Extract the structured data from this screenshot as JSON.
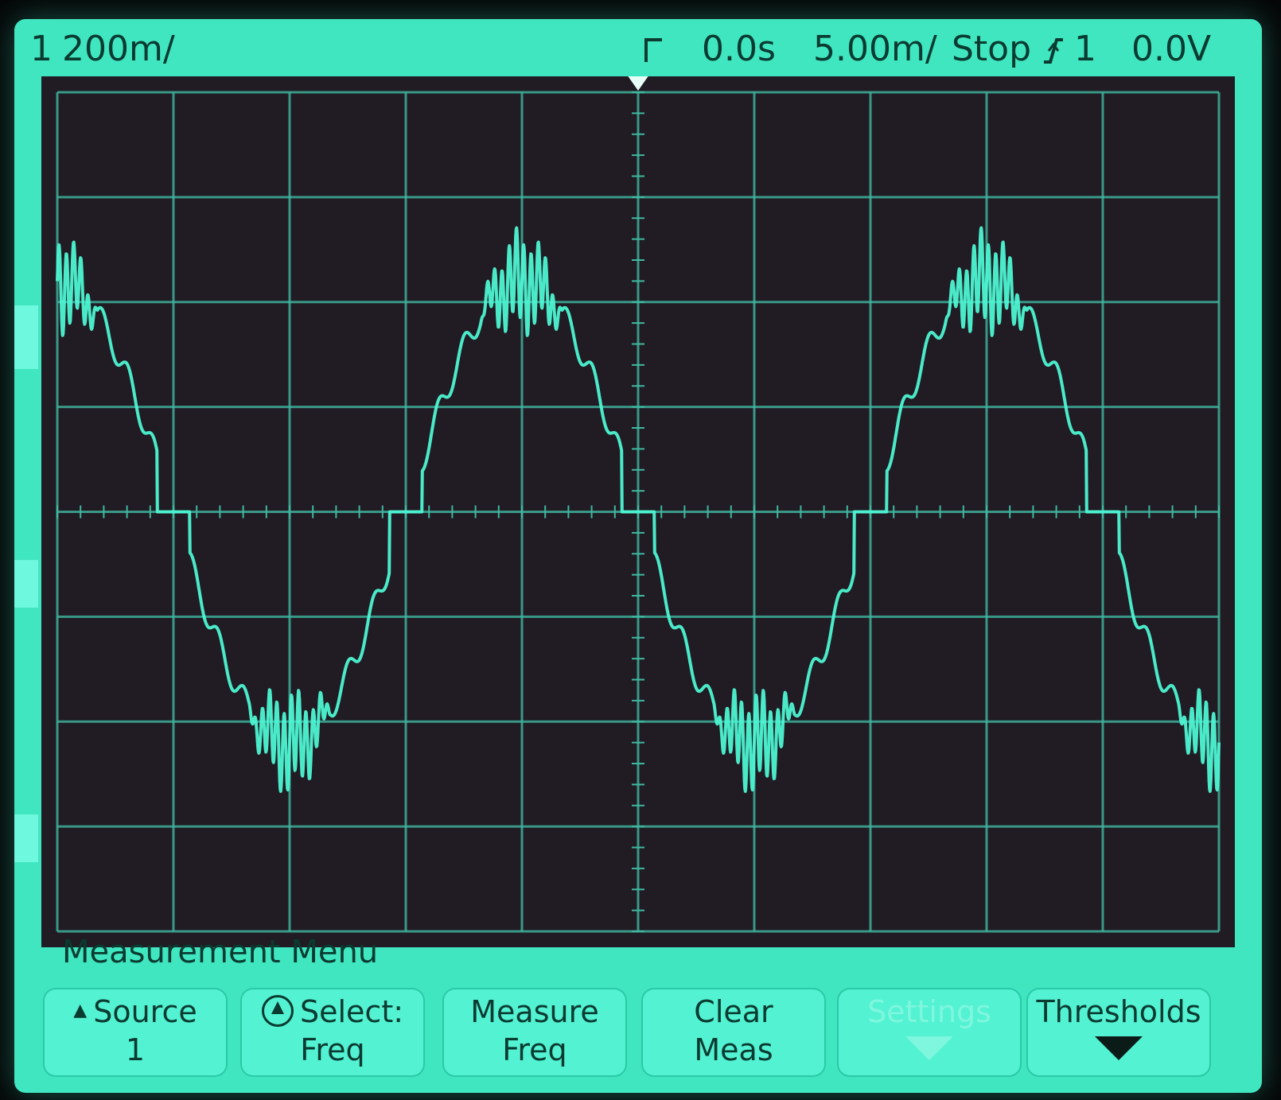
{
  "status": {
    "channel": "1",
    "volts_per_div": "200m/",
    "trigger_icon": "trigger-edge-icon",
    "time_offset": "0.0s",
    "time_per_div": "5.00m/",
    "run_state": "Stop",
    "trigger_source": "1",
    "trigger_level": "0.0V"
  },
  "menu": {
    "title": "Measurement Menu",
    "softkeys": [
      {
        "line1": "Source",
        "line2": "1",
        "icon": "up-triangle-icon",
        "enabled": true
      },
      {
        "line1": "Select:",
        "line2": "Freq",
        "icon": "knob-icon",
        "enabled": true
      },
      {
        "line1": "Measure",
        "line2": "Freq",
        "icon": "",
        "enabled": true
      },
      {
        "line1": "Clear",
        "line2": "Meas",
        "icon": "",
        "enabled": true
      },
      {
        "line1": "Settings",
        "line2": "",
        "icon": "down-arrow-icon",
        "enabled": false
      },
      {
        "line1": "Thresholds",
        "line2": "",
        "icon": "down-arrow-icon",
        "enabled": true
      }
    ]
  },
  "chart_data": {
    "type": "line",
    "title": "",
    "xlabel": "",
    "ylabel": "",
    "x_divisions": 10,
    "y_divisions": 8,
    "grid": true,
    "volts_per_div": 0.2,
    "time_per_div_ms": 5.0,
    "xlim_ms": [
      -25,
      25
    ],
    "ylim_v": [
      -0.8,
      0.8
    ],
    "series": [
      {
        "color": "#4df5d3",
        "description_points": [
          {
            "t_ms": -25.0,
            "v": 0.36
          },
          {
            "t_ms": -23.5,
            "v": 0.32
          },
          {
            "t_ms": -21.0,
            "v": 0.0
          },
          {
            "t_ms": -19.0,
            "v": 0.0
          },
          {
            "t_ms": -17.0,
            "v": -0.3
          },
          {
            "t_ms": -14.0,
            "v": -0.44
          },
          {
            "t_ms": -12.5,
            "v": -0.38
          },
          {
            "t_ms": -10.5,
            "v": 0.0
          },
          {
            "t_ms": -8.5,
            "v": 0.0
          },
          {
            "t_ms": -6.5,
            "v": 0.3
          },
          {
            "t_ms": -4.0,
            "v": 0.42
          },
          {
            "t_ms": -2.0,
            "v": 0.3
          },
          {
            "t_ms": 0.0,
            "v": 0.0
          },
          {
            "t_ms": 2.0,
            "v": -0.3
          },
          {
            "t_ms": 4.5,
            "v": -0.44
          },
          {
            "t_ms": 6.5,
            "v": -0.3
          },
          {
            "t_ms": 8.5,
            "v": 0.0
          },
          {
            "t_ms": 10.5,
            "v": 0.0
          },
          {
            "t_ms": 12.5,
            "v": 0.3
          },
          {
            "t_ms": 14.5,
            "v": 0.42
          },
          {
            "t_ms": 16.5,
            "v": 0.3
          },
          {
            "t_ms": 18.5,
            "v": 0.0
          },
          {
            "t_ms": 20.5,
            "v": 0.0
          },
          {
            "t_ms": 22.5,
            "v": -0.3
          },
          {
            "t_ms": 25.0,
            "v": -0.44
          }
        ],
        "fundamental_hz": 50,
        "harmonic_ripple": true
      }
    ]
  }
}
